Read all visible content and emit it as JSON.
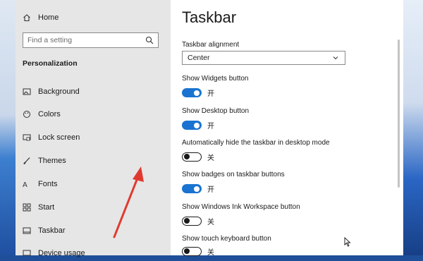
{
  "sidebar": {
    "home": {
      "label": "Home",
      "icon": "home-icon"
    },
    "search": {
      "placeholder": "Find a setting",
      "icon": "search-icon"
    },
    "section_title": "Personalization",
    "items": [
      {
        "label": "Background",
        "icon": "image-icon"
      },
      {
        "label": "Colors",
        "icon": "palette-icon"
      },
      {
        "label": "Lock screen",
        "icon": "monitor-lock-icon"
      },
      {
        "label": "Themes",
        "icon": "brush-icon"
      },
      {
        "label": "Fonts",
        "icon": "fonts-icon"
      },
      {
        "label": "Start",
        "icon": "grid-icon"
      },
      {
        "label": "Taskbar",
        "icon": "taskbar-icon"
      },
      {
        "label": "Device usage",
        "icon": "device-icon"
      }
    ]
  },
  "main": {
    "title": "Taskbar",
    "alignment": {
      "label": "Taskbar alignment",
      "value": "Center"
    },
    "settings": [
      {
        "label": "Show Widgets button",
        "state": "开",
        "on": true
      },
      {
        "label": "Show Desktop button",
        "state": "开",
        "on": true
      },
      {
        "label": "Automatically hide the taskbar in desktop mode",
        "state": "关",
        "on": false
      },
      {
        "label": "Show badges on taskbar buttons",
        "state": "开",
        "on": true
      },
      {
        "label": "Show Windows Ink Workspace button",
        "state": "关",
        "on": false
      },
      {
        "label": "Show touch keyboard button",
        "state": "关",
        "on": false
      }
    ]
  },
  "colors": {
    "accent": "#1a73d1",
    "annotation_arrow": "#e03a30",
    "sidebar_bg": "#e6e6e6"
  }
}
